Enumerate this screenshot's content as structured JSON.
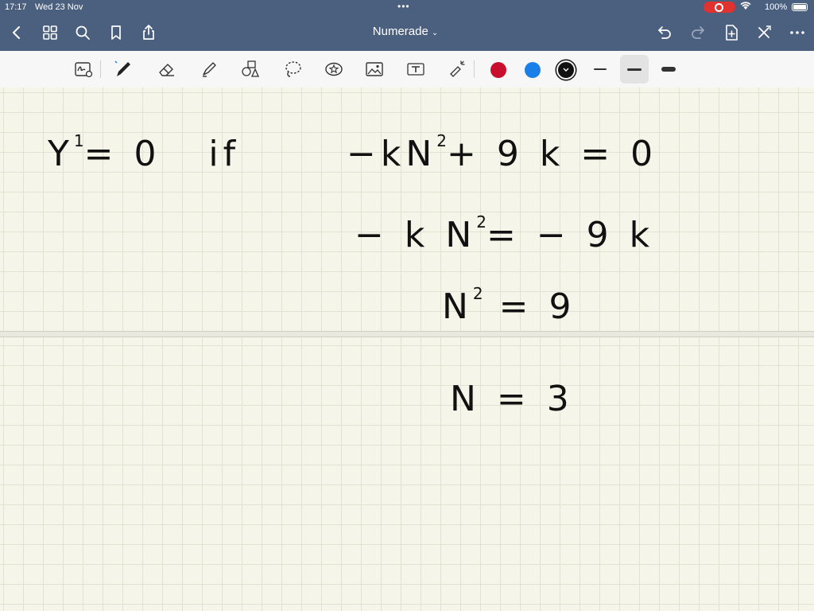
{
  "status_bar": {
    "time": "17:17",
    "date": "Wed 23 Nov",
    "battery": "100%"
  },
  "nav": {
    "title": "Numerade",
    "caret": "⌄"
  },
  "toolbar": {
    "colors": [
      "#c8102e",
      "#1a7fe8",
      "#111111"
    ]
  },
  "notes": {
    "line1": {
      "left": "Y",
      "prime": "1",
      "rest": "= 0   if"
    },
    "line1_right": {
      "a": "−kN",
      "exp": "2",
      "b": "+ 9 k = 0"
    },
    "line2": {
      "a": "− k N",
      "exp": "2",
      "b": "= − 9 k"
    },
    "line3": {
      "a": "N",
      "exp": "2",
      "b": " = 9"
    },
    "line4": "N = 3"
  }
}
